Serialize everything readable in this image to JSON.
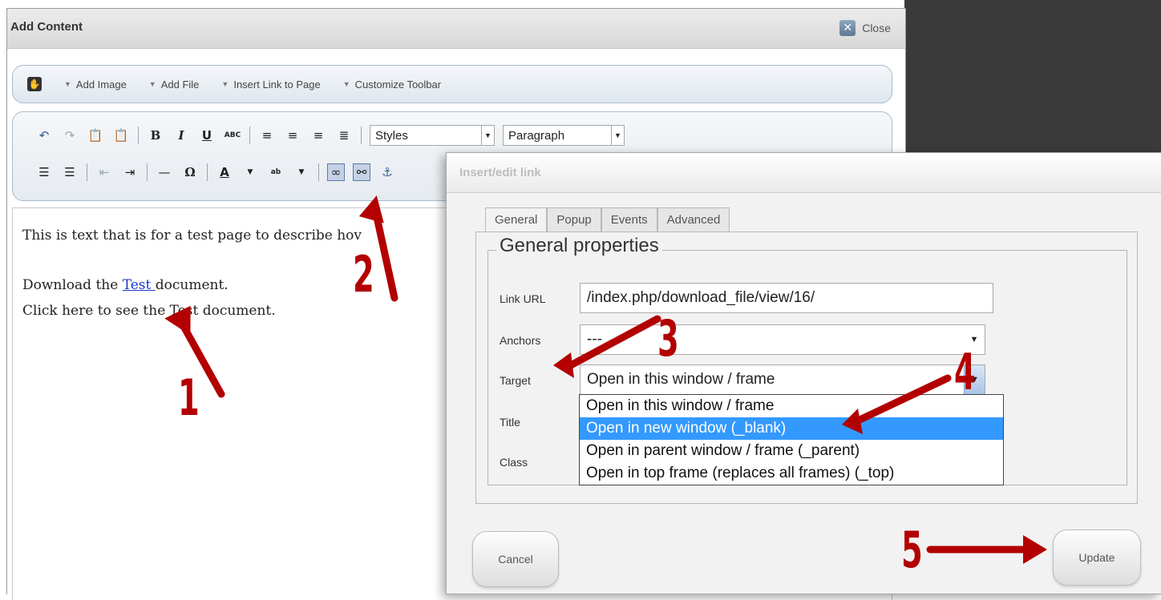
{
  "main_dialog": {
    "title": "Add Content",
    "close_label": "Close"
  },
  "concrete_toolbar": {
    "items": [
      "Add Image",
      "Add File",
      "Insert Link to Page",
      "Customize Toolbar"
    ]
  },
  "editor_toolbar": {
    "styles_value": "Styles",
    "format_value": "Paragraph"
  },
  "editor": {
    "line1": "This is text that is for a test page to describe hov",
    "line2_pre": "Download the ",
    "line2_link": "Test ",
    "line2_post": "document.",
    "line3": "Click here to see the Test document."
  },
  "link_dialog": {
    "title": "Insert/edit link",
    "tabs": [
      "General",
      "Popup",
      "Events",
      "Advanced"
    ],
    "legend": "General properties",
    "fields": {
      "link_url_label": "Link URL",
      "link_url_value": "/index.php/download_file/view/16/",
      "anchors_label": "Anchors",
      "anchors_value": "---",
      "target_label": "Target",
      "target_value": "Open in this window / frame",
      "title_label": "Title",
      "class_label": "Class"
    },
    "target_options": [
      "Open in this window / frame",
      "Open in new window (_blank)",
      "Open in parent window / frame (_parent)",
      "Open in top frame (replaces all frames) (_top)"
    ],
    "highlighted_option": "Open in new window (_blank)",
    "cancel_label": "Cancel",
    "update_label": "Update"
  },
  "annotations": {
    "numbers": [
      "1",
      "2",
      "3",
      "4",
      "5"
    ],
    "color": "#b30000"
  }
}
